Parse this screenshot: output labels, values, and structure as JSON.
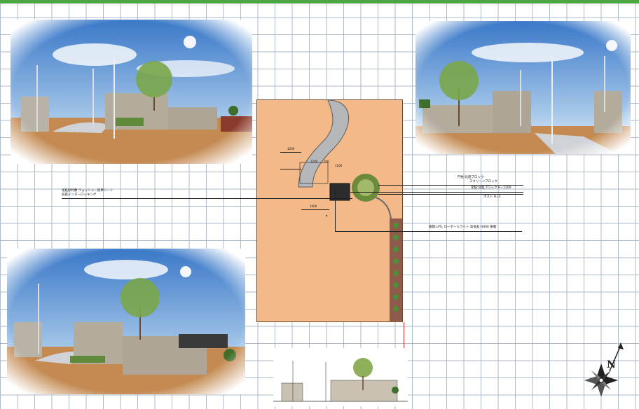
{
  "plan": {
    "dimensions": [
      "1200",
      "1200",
      "200",
      "1200",
      "1000"
    ],
    "labels": {
      "left_line1": "化粧砂利敷 ウォッシャー防草シート",
      "left_line2": "前庭インターロッキング",
      "right_1_line1": "門柱:化粧ブロック",
      "right_1_line2": "スクリーンブロック",
      "right_2_line1": "化粧:化粧ブロック H=1200",
      "right_2_line2": "ポスト H=1",
      "right_3": "植栽:LPS, ローボールライト 高低差 H400 植栽"
    }
  },
  "compass": {
    "north_label": "N"
  },
  "colors": {
    "grid": "#aebac7",
    "top_border": "#4da543",
    "plan_ground": "#f3b988",
    "path": "#b5b8bb",
    "red_line": "#e03030"
  }
}
